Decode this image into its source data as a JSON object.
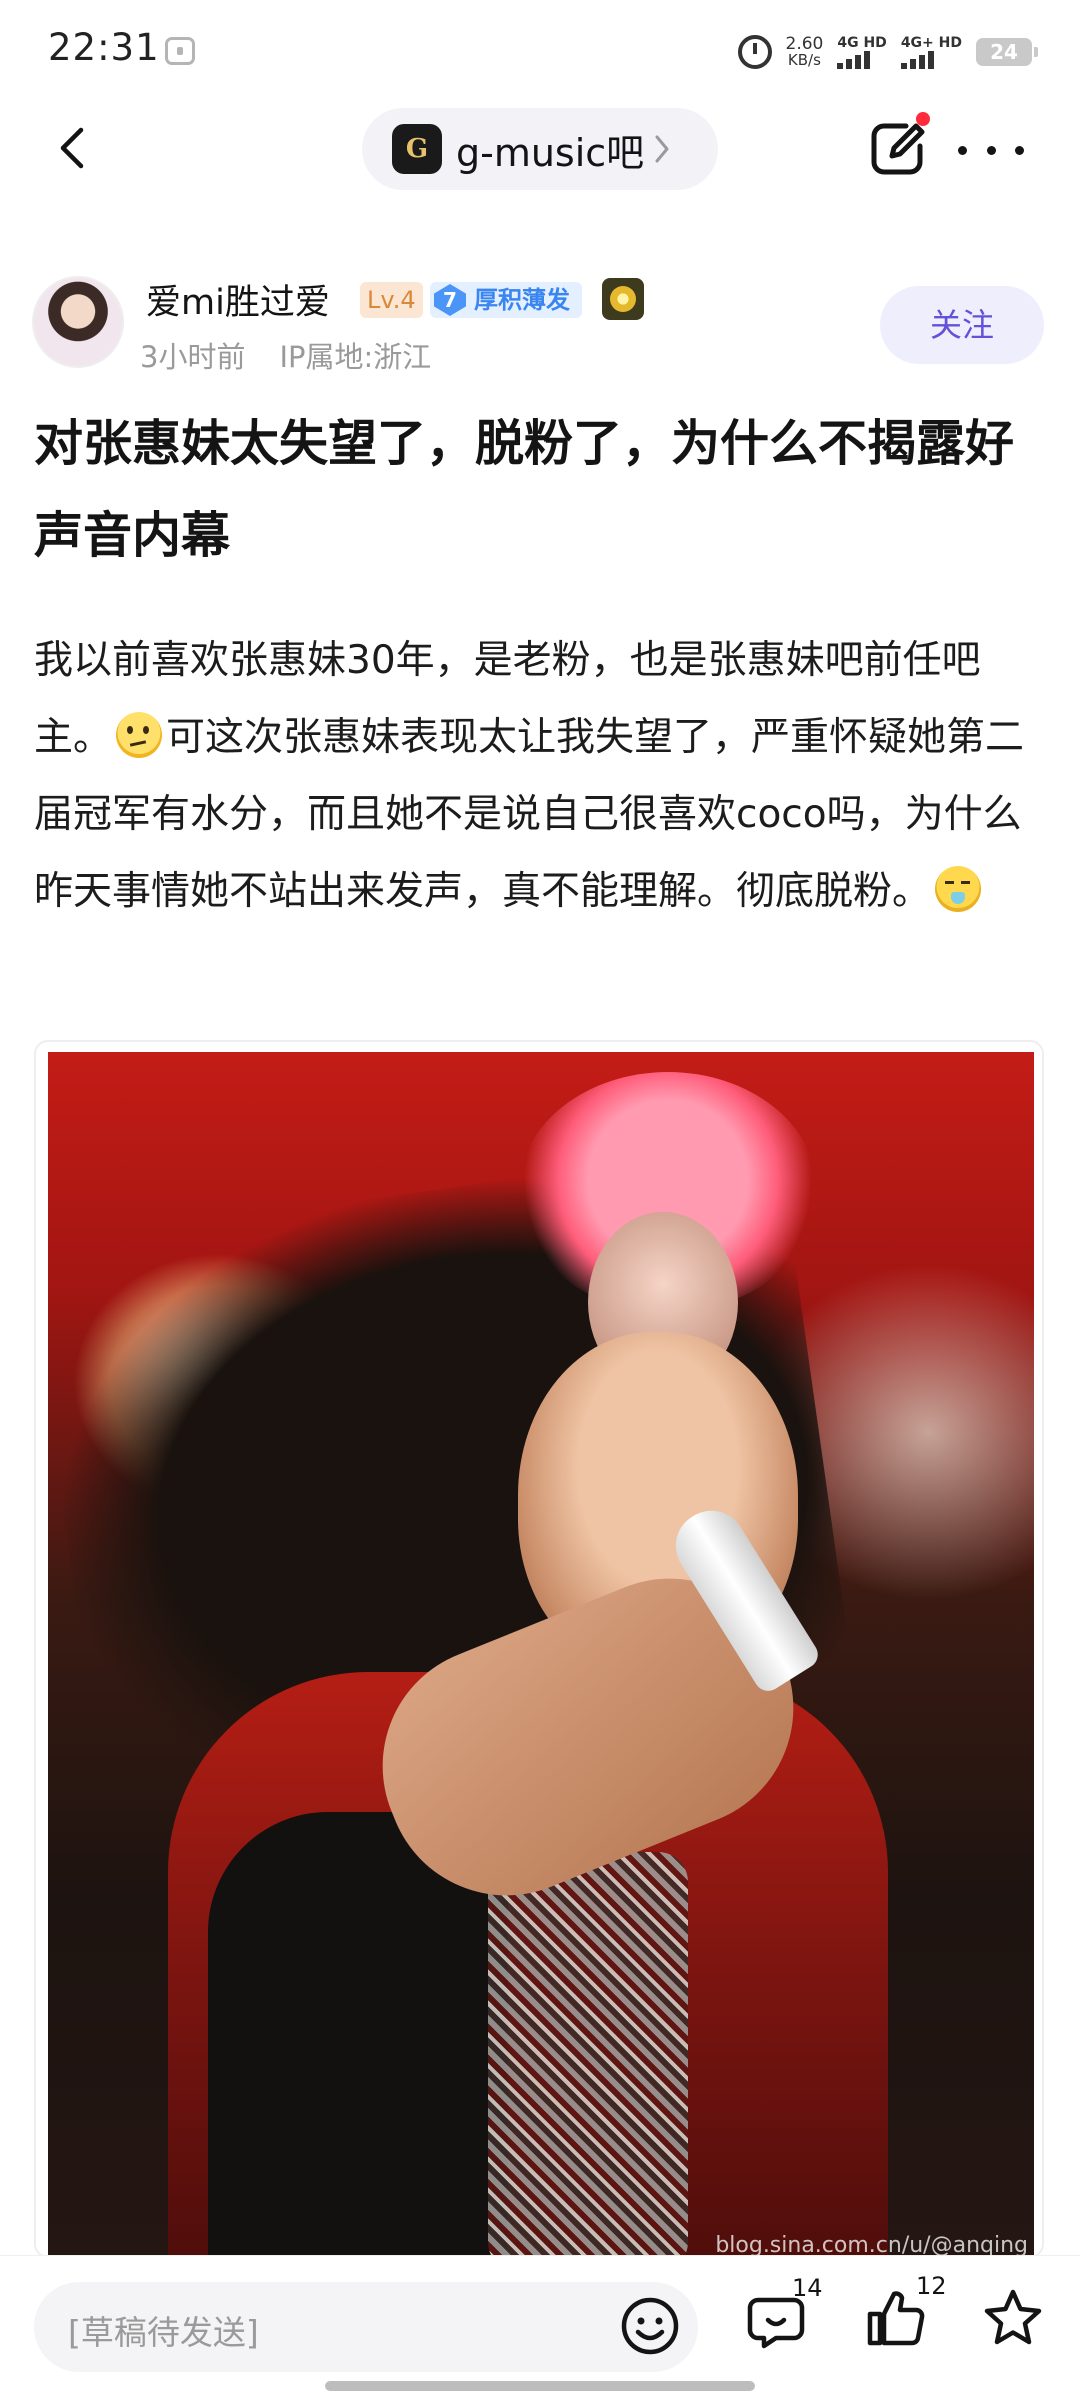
{
  "status_bar": {
    "time": "22:31",
    "net_speed_value": "2.60",
    "net_speed_unit": "KB/s",
    "signal1_label": "4G HD",
    "signal2_label": "4G+ HD",
    "battery": "24"
  },
  "nav": {
    "forum_logo_text": "G",
    "forum_name": "g-music吧"
  },
  "author": {
    "name": "爱mi胜过爱",
    "level": "Lv.4",
    "honor_number": "7",
    "honor_label": "厚积薄发",
    "time_ago": "3小时前",
    "ip_location": "IP属地:浙江",
    "follow_label": "关注"
  },
  "post": {
    "title": "对张惠妹太失望了，脱粉了，为什么不揭露好声音内幕",
    "body_part1": "我以前喜欢张惠妹30年，是老粉，也是张惠妹吧前任吧主。",
    "body_part2": "可这次张惠妹表现太让我失望了，严重怀疑她第二届冠军有水分，而且她不是说自己很喜欢coco吗，为什么昨天事情她不站出来发声，真不能理解。彻底脱粉。",
    "emoji1": "thinking-face-icon",
    "emoji2": "vomiting-face-icon",
    "photo_watermark": "blog.sina.com.cn/u/@anqing"
  },
  "bottom_bar": {
    "draft_placeholder": "[草稿待发送]",
    "comment_count": "14",
    "like_count": "12"
  },
  "colors": {
    "accent": "#6152d9",
    "follow_bg": "#efeefc",
    "notification_dot": "#ff2b3d",
    "level_badge": "#d9883a",
    "honor_badge": "#3a86f0"
  }
}
